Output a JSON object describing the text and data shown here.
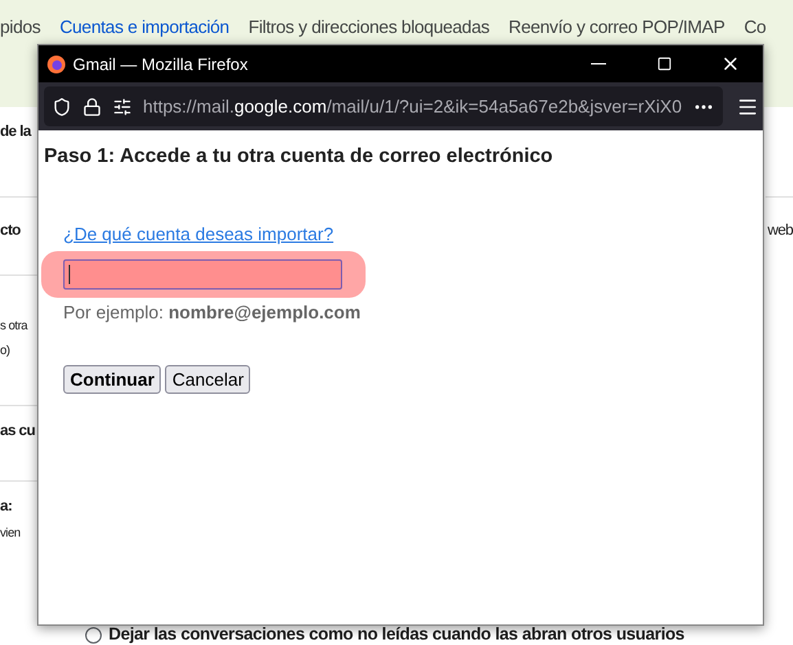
{
  "background": {
    "tabs": [
      {
        "label": "pidos",
        "selected": false
      },
      {
        "label": "Cuentas e importación",
        "selected": true
      },
      {
        "label": "Filtros y direcciones bloqueadas",
        "selected": false
      },
      {
        "label": "Reenvío y correo POP/IMAP",
        "selected": false
      },
      {
        "label": "Co",
        "selected": false
      }
    ],
    "left_fragments": [
      {
        "text": "de la",
        "kind": "heading"
      },
      {
        "text": "cto",
        "kind": "heading"
      },
      {
        "text": "s otra",
        "kind": "small"
      },
      {
        "text": "o)",
        "kind": "small"
      },
      {
        "text": "as cu",
        "kind": "heading"
      },
      {
        "text": "a:",
        "kind": "heading"
      },
      {
        "text": "vien",
        "kind": "small"
      }
    ],
    "right_fragment": "web",
    "radio_option": {
      "label": "Dejar las conversaciones como no leídas cuando las abran otros usuarios",
      "selected": false
    }
  },
  "window": {
    "title": "Gmail — Mozilla Firefox",
    "url": {
      "prefix": "https://mail.",
      "domain": "google.com",
      "suffix": "/mail/u/1/?ui=2&ik=54a5a67e2b&jsver=rXiX0"
    },
    "heading": "Paso 1: Accede a tu otra cuenta de correo electrónico",
    "field_label": "¿De qué cuenta deseas importar?",
    "field_highlighted": true,
    "hint": "Por ejemplo: **nombre@ejemplo.com**",
    "buttons": [
      {
        "label": "Continuar",
        "kind": "primary"
      },
      {
        "label": "Cancelar",
        "kind": "secondary"
      }
    ]
  }
}
